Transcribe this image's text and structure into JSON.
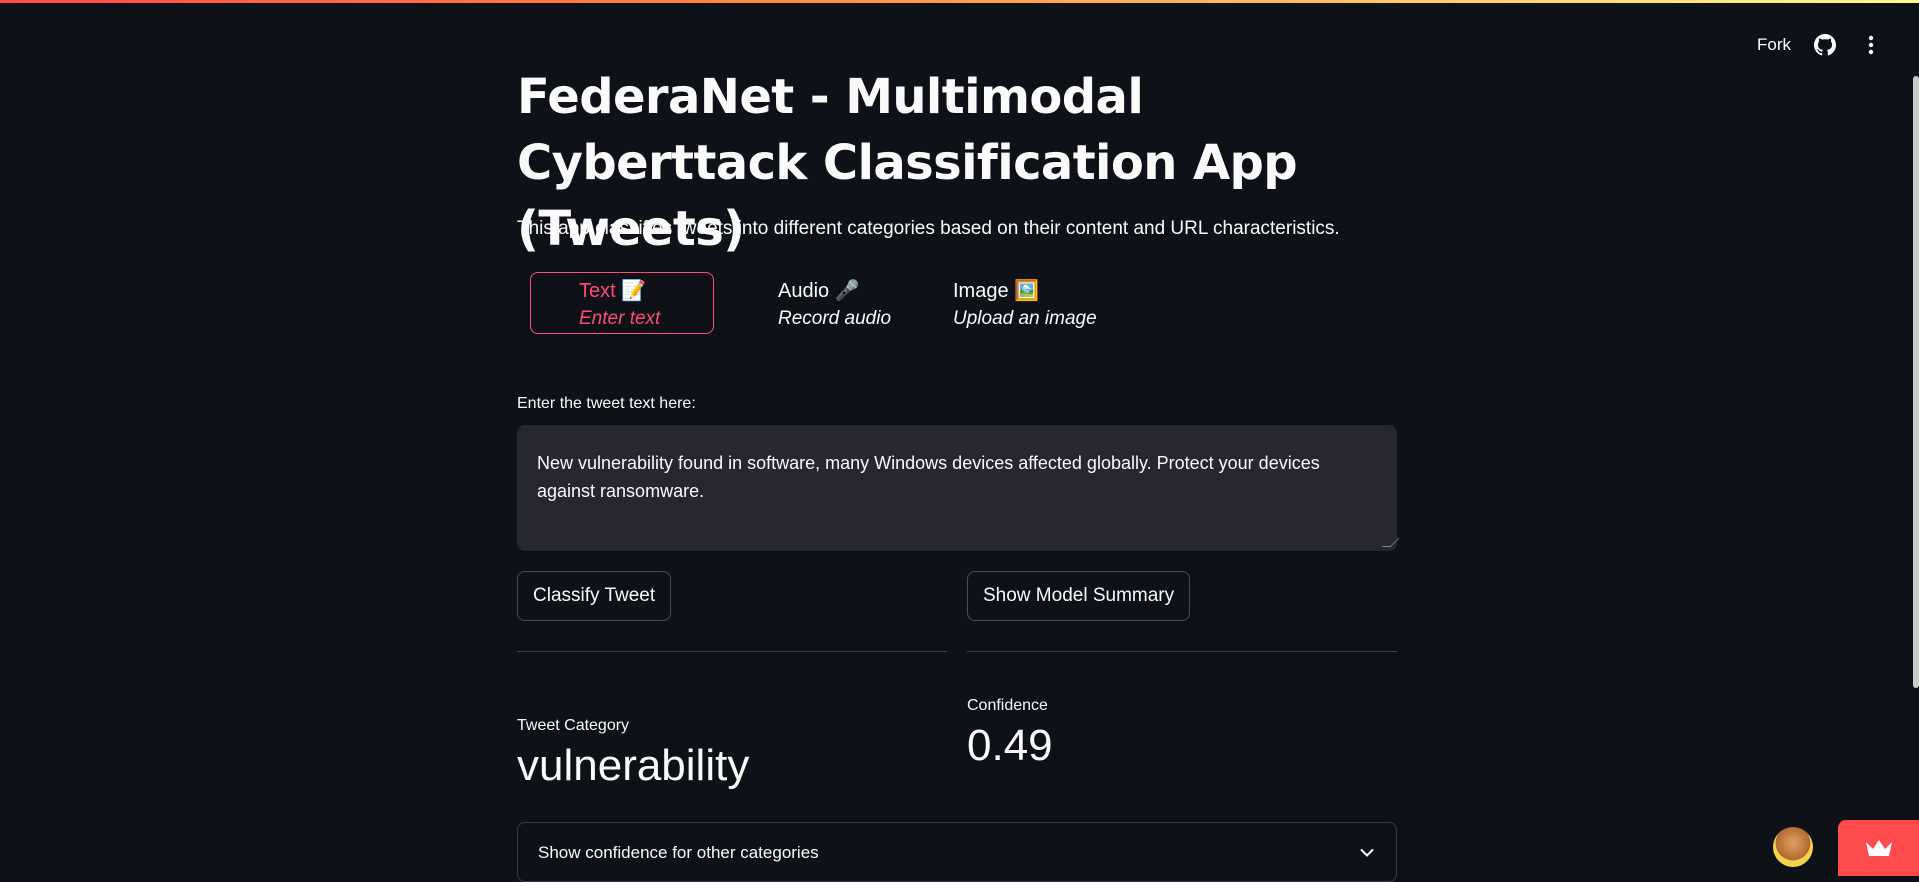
{
  "header": {
    "fork_label": "Fork",
    "github_icon": "github-icon",
    "menu_icon": "kebab-menu-icon"
  },
  "page": {
    "title": "FederaNet - Multimodal Cyberttack Classification App (Tweets)",
    "description": "This app classifies tweets into different categories based on their content and URL characteristics."
  },
  "tabs": [
    {
      "label": "Text 📝",
      "sub": "Enter text",
      "active": true
    },
    {
      "label": "Audio 🎤",
      "sub": "Record audio",
      "active": false
    },
    {
      "label": "Image 🖼️",
      "sub": "Upload an image",
      "active": false
    }
  ],
  "input": {
    "label": "Enter the tweet text here:",
    "value": "New vulnerability found in software, many Windows devices affected globally. Protect your devices against ransomware."
  },
  "buttons": {
    "classify": "Classify Tweet",
    "summary": "Show Model Summary"
  },
  "metrics": {
    "category_label": "Tweet Category",
    "category_value": "vulnerability",
    "confidence_label": "Confidence",
    "confidence_value": "0.49"
  },
  "expander": {
    "label": "Show confidence for other categories"
  },
  "colors": {
    "background": "#0e1117",
    "accent": "#ff4b75",
    "input_bg": "#262730",
    "badge": "#ff4b4b"
  }
}
